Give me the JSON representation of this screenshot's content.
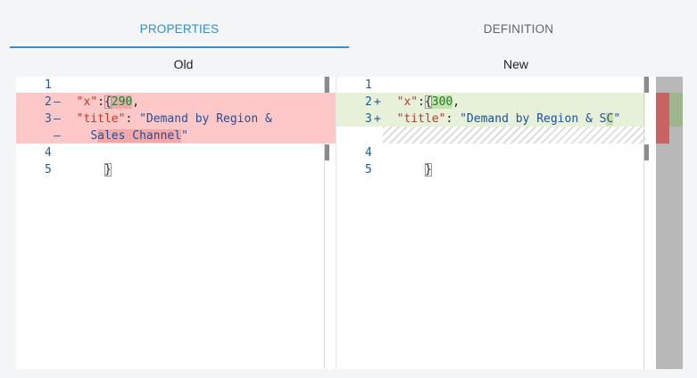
{
  "tabs": [
    {
      "label": "PROPERTIES",
      "active": true
    },
    {
      "label": "DEFINITION",
      "active": false
    }
  ],
  "old_pane": {
    "title": "Old",
    "line_numbers": [
      "1",
      "2",
      "3",
      "4",
      "5"
    ],
    "markers": {
      "line2": "—",
      "line3": "—",
      "wrap": "—"
    },
    "lines": {
      "open_brace": "{",
      "x_key": "\"x\"",
      "x_colon": ": ",
      "x_value": "290",
      "x_comma": ",",
      "title_key": "\"title\"",
      "title_colon": ": ",
      "title_value_a": "\"Demand by Region &",
      "title_value_b_pre": "S",
      "title_value_b_changed": "ales Channel",
      "title_value_b_post": "\"",
      "close_brace": "}"
    }
  },
  "new_pane": {
    "title": "New",
    "line_numbers": [
      "1",
      "2",
      "3",
      "4",
      "5"
    ],
    "markers": {
      "line2": "+",
      "line3": "+"
    },
    "lines": {
      "open_brace": "{",
      "x_key": "\"x\"",
      "x_colon": ": ",
      "x_value": "300",
      "x_comma": ",",
      "title_key": "\"title\"",
      "title_colon": ": ",
      "title_value_pre": "\"Demand by Region & S",
      "title_value_changed": "C",
      "title_value_post": "\"",
      "close_brace": "}"
    }
  },
  "colors": {
    "accent": "#2f8fd8",
    "deleted_bg": "#ffc8c8",
    "inserted_bg": "#e7f0d8"
  }
}
